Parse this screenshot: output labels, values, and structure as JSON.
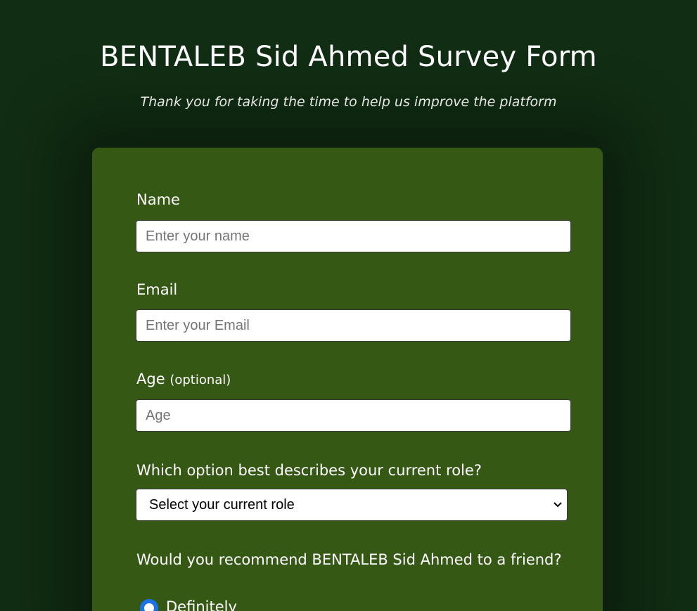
{
  "header": {
    "title": "BENTALEB Sid Ahmed Survey Form",
    "description": "Thank you for taking the time to help us improve the platform"
  },
  "form": {
    "name": {
      "label": "Name",
      "placeholder": "Enter your name"
    },
    "email": {
      "label": "Email",
      "placeholder": "Enter your Email"
    },
    "age": {
      "label": "Age",
      "label_note": "(optional)",
      "placeholder": "Age"
    },
    "role": {
      "label": "Which option best describes your current role?",
      "selected": "Select your current role"
    },
    "recommend": {
      "label": "Would you recommend BENTALEB Sid Ahmed to a friend?",
      "options": [
        {
          "label": "Definitely",
          "checked": true
        }
      ]
    }
  },
  "colors": {
    "page_background": "#112d13",
    "card_background": "#355815",
    "radio_accent": "#1a73e8"
  }
}
